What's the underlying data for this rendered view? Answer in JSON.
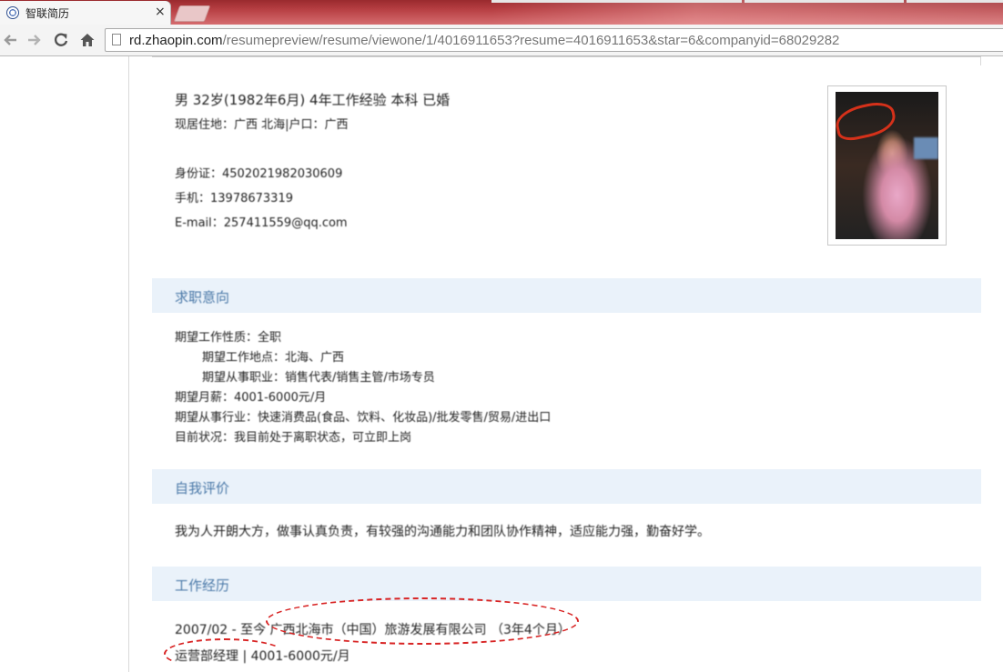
{
  "browser": {
    "tab_title": "智联简历",
    "tab_close": "×",
    "url_host": "rd.zhaopin.com",
    "url_path": "/resumepreview/resume/viewone/1/4016911653?resume=4016911653&star=6&companyid=68029282"
  },
  "resume": {
    "basic_line": "男  32岁(1982年6月)  4年工作经验  本科  已婚",
    "location_line": "现居住地：广西 北海|户口：广西",
    "id_line": "身份证：4502021982030609",
    "phone_line": "手机：13978673319",
    "email_line": "E-mail：257411559@qq.com",
    "sections": {
      "intention_title": "求职意向",
      "self_eval_title": "自我评价",
      "work_title": "工作经历"
    },
    "intention_rows": [
      "期望工作性质：全职",
      "期望工作地点：北海、广西",
      "期望从事职业：销售代表/销售主管/市场专员",
      "期望月薪：4001-6000元/月",
      "期望从事行业：快速消费品(食品、饮料、化妆品)/批发零售/贸易/进出口",
      "目前状况：我目前处于离职状态，可立即上岗"
    ],
    "self_eval_text": "我为人开朗大方，做事认真负责，有较强的沟通能力和团队协作精神，适应能力强，勤奋好学。",
    "work_line1": "2007/02 - 至今  广西北海市（中国）旅游发展有限公司  （3年4个月）",
    "work_line2": "运营部经理 | 4001-6000元/月"
  },
  "colors": {
    "tab_strip": "#b84044",
    "section_bg": "#eaf2fa",
    "section_title": "#4b79a8",
    "annotation_red": "#d82424"
  }
}
